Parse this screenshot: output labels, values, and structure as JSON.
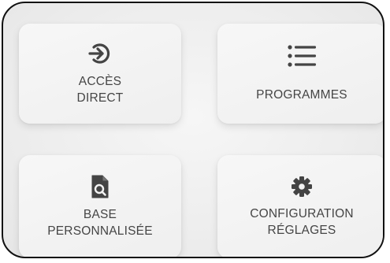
{
  "tiles": [
    {
      "id": "acces",
      "label_line1": "ACCÈS",
      "label_line2": "DIRECT",
      "icon": "sign-in-icon"
    },
    {
      "id": "programmes",
      "label_line1": "PROGRAMMES",
      "icon": "list-icon"
    },
    {
      "id": "base",
      "label_line1": "BASE",
      "label_line2": "PERSONNALISÉE",
      "icon": "file-search-icon"
    },
    {
      "id": "config",
      "label_line1": "CONFIGURATION",
      "label_line2": "RÉGLAGES",
      "icon": "gear-icon"
    }
  ],
  "colors": {
    "text": "#454545",
    "icon": "#444444",
    "tile_bg": "#f3f3f3",
    "frame": "#111111"
  }
}
